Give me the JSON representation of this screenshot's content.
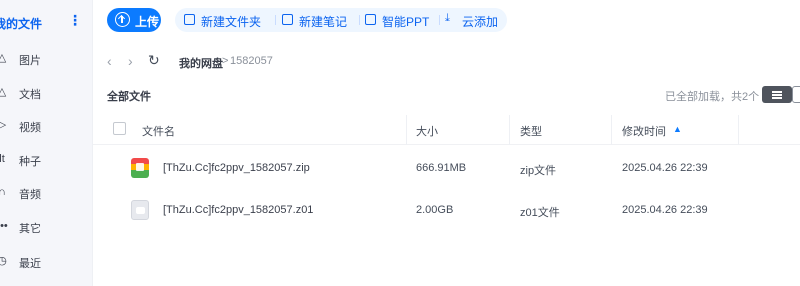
{
  "sidebar": {
    "title": "我的文件",
    "more_icon": "more-vertical-icon",
    "items": [
      {
        "label": "图片",
        "icon": "triangle-icon",
        "glyph": "△"
      },
      {
        "label": "文档",
        "icon": "triangle-icon",
        "glyph": "△"
      },
      {
        "label": "视频",
        "icon": "play-icon",
        "glyph": "▷"
      },
      {
        "label": "种子",
        "icon": "bt-icon",
        "glyph": "lt"
      },
      {
        "label": "音频",
        "icon": "headphone-icon",
        "glyph": "∩"
      },
      {
        "label": "其它",
        "icon": "more-icon",
        "glyph": "•••"
      },
      {
        "label": "最近",
        "icon": "clock-icon",
        "glyph": "◷"
      }
    ]
  },
  "toolbar": {
    "upload": "上传",
    "new_folder": "新建文件夹",
    "new_note": "新建笔记",
    "smart_ppt": "智能PPT",
    "cloud_add": "云添加"
  },
  "nav": {
    "back": "‹",
    "forward": "›",
    "refresh": "↻",
    "root": "我的网盘",
    "sep": ">",
    "current": "1582057"
  },
  "section": {
    "title": "全部文件",
    "loaded_text": "已全部加载，共2个"
  },
  "table": {
    "headers": {
      "name": "文件名",
      "size": "大小",
      "type": "类型",
      "modified": "修改时间"
    },
    "rows": [
      {
        "name": "[ThZu.Cc]fc2ppv_1582057.zip",
        "size": "666.91MB",
        "type": "zip文件",
        "modified": "2025.04.26 22:39",
        "icon": "zip-file-icon"
      },
      {
        "name": "[ThZu.Cc]fc2ppv_1582057.z01",
        "size": "2.00GB",
        "type": "z01文件",
        "modified": "2025.04.26 22:39",
        "icon": "generic-file-icon"
      }
    ]
  },
  "colors": {
    "accent": "#0c7bff",
    "accent_text": "#0c64f0",
    "toolbar_bg": "#eef6ff",
    "sidebar_bg": "#f5f6fa"
  }
}
